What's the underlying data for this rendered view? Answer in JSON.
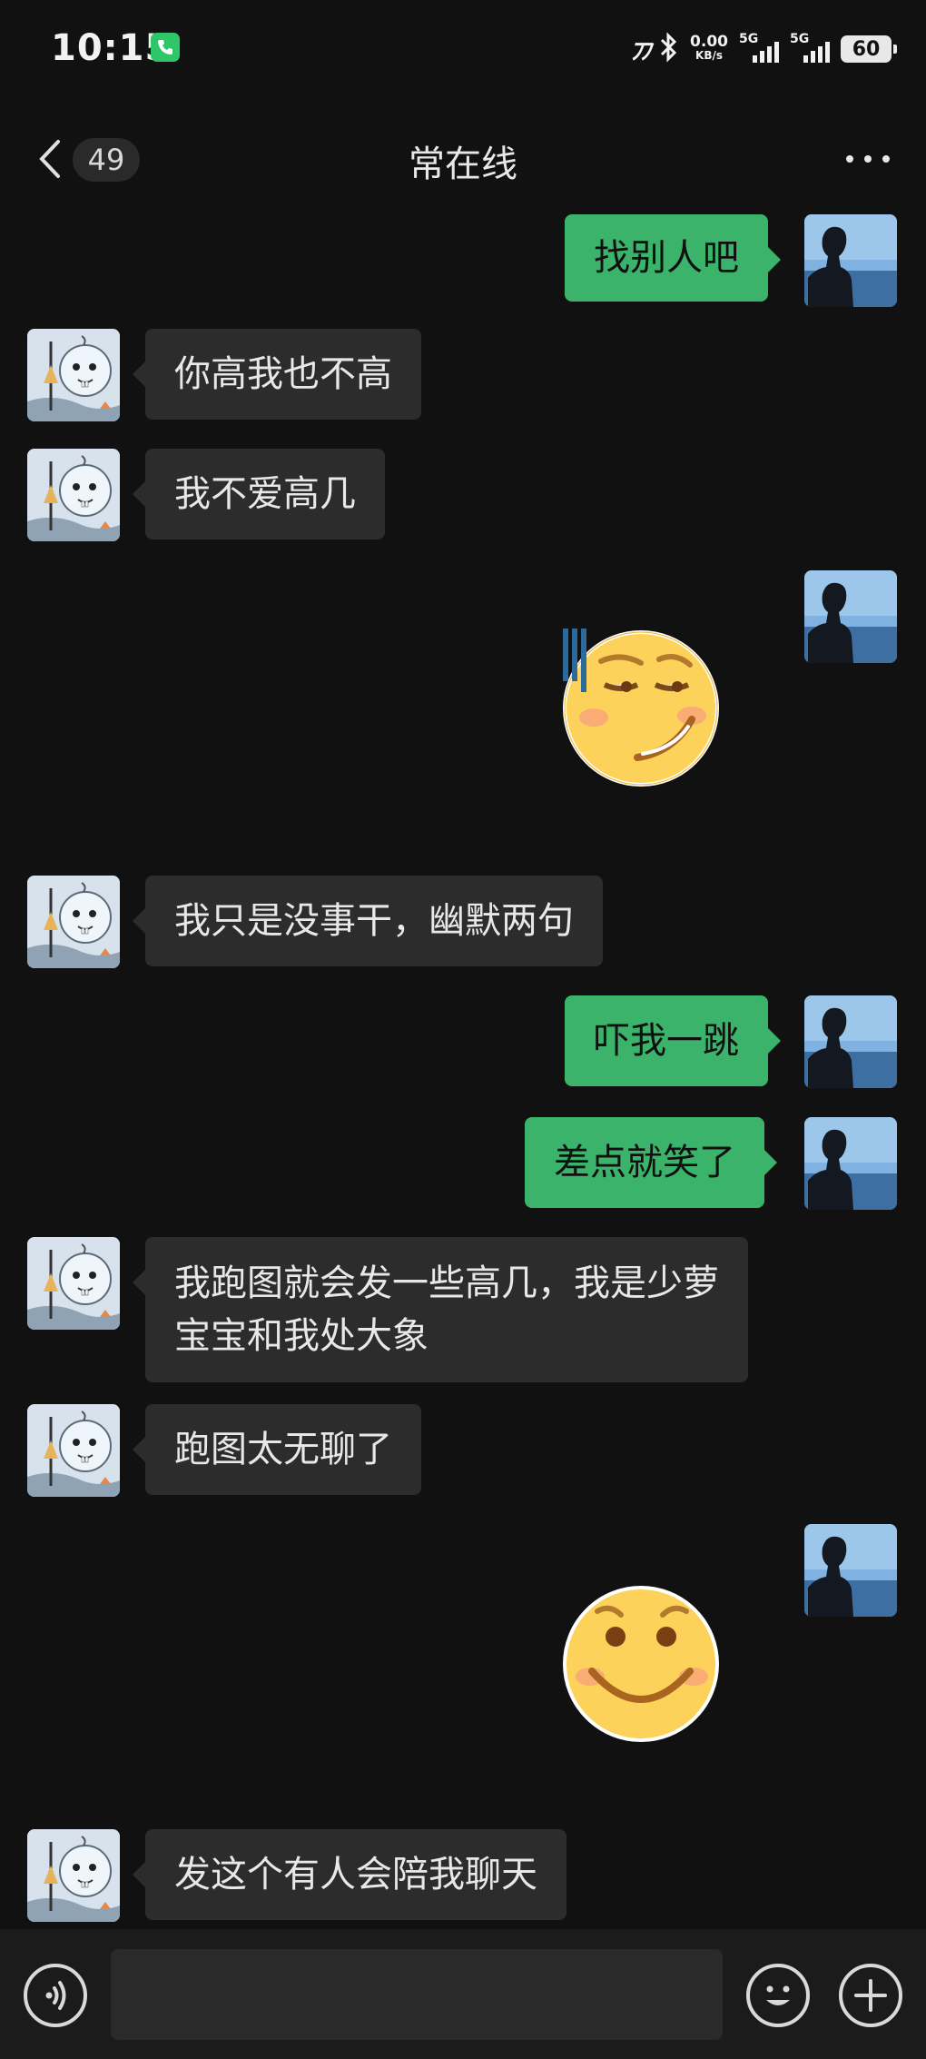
{
  "status_bar": {
    "time": "10:15",
    "net_speed_value": "0.00",
    "net_speed_unit": "KB/s",
    "sim1": "5G",
    "sim2": "5G",
    "battery": "60"
  },
  "header": {
    "unread_count": "49",
    "title": "常在线"
  },
  "messages": [
    {
      "sender": "me",
      "text": "找别人吧"
    },
    {
      "sender": "other",
      "text": "你高我也不高"
    },
    {
      "sender": "other",
      "text": "我不爱高几"
    },
    {
      "sender": "me",
      "sticker": "sweat-smirk-emoji-sticker"
    },
    {
      "sender": "other",
      "text": "我只是没事干，幽默两句"
    },
    {
      "sender": "me",
      "text": "吓我一跳"
    },
    {
      "sender": "me",
      "text": "差点就笑了"
    },
    {
      "sender": "other",
      "text_line1": "我跑图就会发一些高几，我是少萝",
      "text_line2": "宝宝和我处大象"
    },
    {
      "sender": "other",
      "text": "跑图太无聊了"
    },
    {
      "sender": "me",
      "sticker": "smile-emoji-sticker"
    },
    {
      "sender": "other",
      "text": "发这个有人会陪我聊天"
    }
  ],
  "input_bar": {
    "value": "",
    "icons": [
      "voice-icon",
      "emoji-icon",
      "plus-icon"
    ]
  },
  "colors": {
    "background": "#111111",
    "my_bubble": "#3bb36b",
    "other_bubble": "#2c2c2c"
  }
}
